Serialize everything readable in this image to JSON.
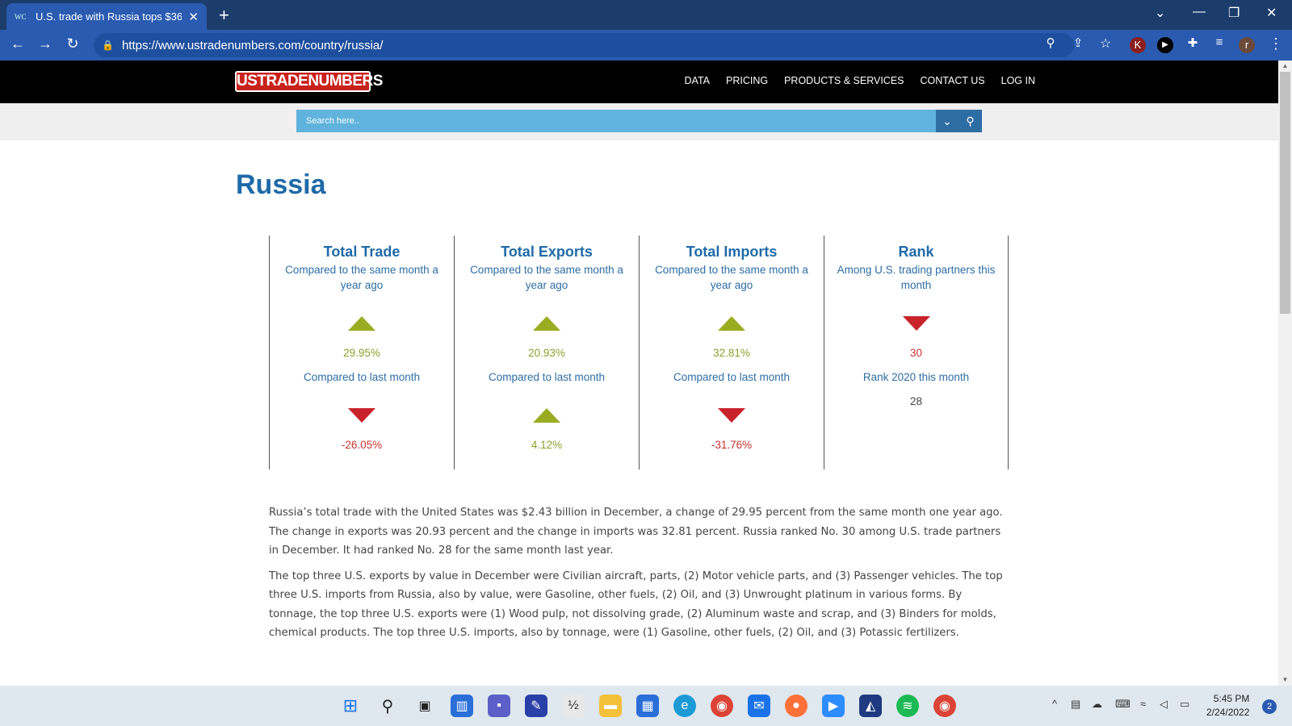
{
  "browser": {
    "tab_title": "U.S. trade with Russia tops $36.0",
    "tab_favicon": "WC",
    "url": "https://www.ustradenumbers.com/country/russia/",
    "profile_initial": "r",
    "extension_initial": "K"
  },
  "site": {
    "logo": "USTRADENUMBERS",
    "nav": [
      "DATA",
      "PRICING",
      "PRODUCTS & SERVICES",
      "CONTACT US",
      "LOG IN"
    ],
    "search_placeholder": "Search here.."
  },
  "page": {
    "title": "Russia",
    "stats": [
      {
        "heading": "Total Trade",
        "subtitle": "Compared to the same month a year ago",
        "yoy_value": "29.95%",
        "yoy_direction": "up",
        "mom_label": "Compared to last month",
        "mom_value": "-26.05%",
        "mom_direction": "down"
      },
      {
        "heading": "Total Exports",
        "subtitle": "Compared to the same month a year ago",
        "yoy_value": "20.93%",
        "yoy_direction": "up",
        "mom_label": "Compared to last month",
        "mom_value": "4.12%",
        "mom_direction": "up"
      },
      {
        "heading": "Total Imports",
        "subtitle": "Compared to the same month a year ago",
        "yoy_value": "32.81%",
        "yoy_direction": "up",
        "mom_label": "Compared to last month",
        "mom_value": "-31.76%",
        "mom_direction": "down"
      }
    ],
    "rank": {
      "heading": "Rank",
      "subtitle": "Among U.S. trading partners this month",
      "value": "30",
      "direction": "down",
      "prev_label": "Rank 2020 this month",
      "prev_value": "28"
    },
    "paragraphs": [
      "Russia’s total trade with the United States was $2.43 billion in December, a change of 29.95 percent from the same month one year ago. The change in exports was 20.93 percent and the change in imports was 32.81 percent. Russia ranked No. 30 among U.S. trade partners in December. It had ranked No. 28 for the same month last year.",
      "The top three U.S. exports by value in December were Civilian aircraft, parts, (2) Motor vehicle parts, and (3) Passenger vehicles. The top three U.S. imports from Russia, also by value, were Gasoline, other fuels, (2) Oil, and (3) Unwrought platinum in various forms. By tonnage, the top three U.S. exports were (1) Wood pulp, not dissolving grade, (2) Aluminum waste and scrap, and (3) Binders for molds, chemical products. The top three U.S. imports, also by tonnage, were (1) Gasoline, other fuels, (2) Oil, and (3) Potassic fertilizers."
    ]
  },
  "taskbar": {
    "time": "5:45 PM",
    "date": "2/24/2022",
    "notifications": "2"
  },
  "colors": {
    "accent": "#1e6aa8",
    "up": "#9aad22",
    "down": "#c8222b"
  }
}
